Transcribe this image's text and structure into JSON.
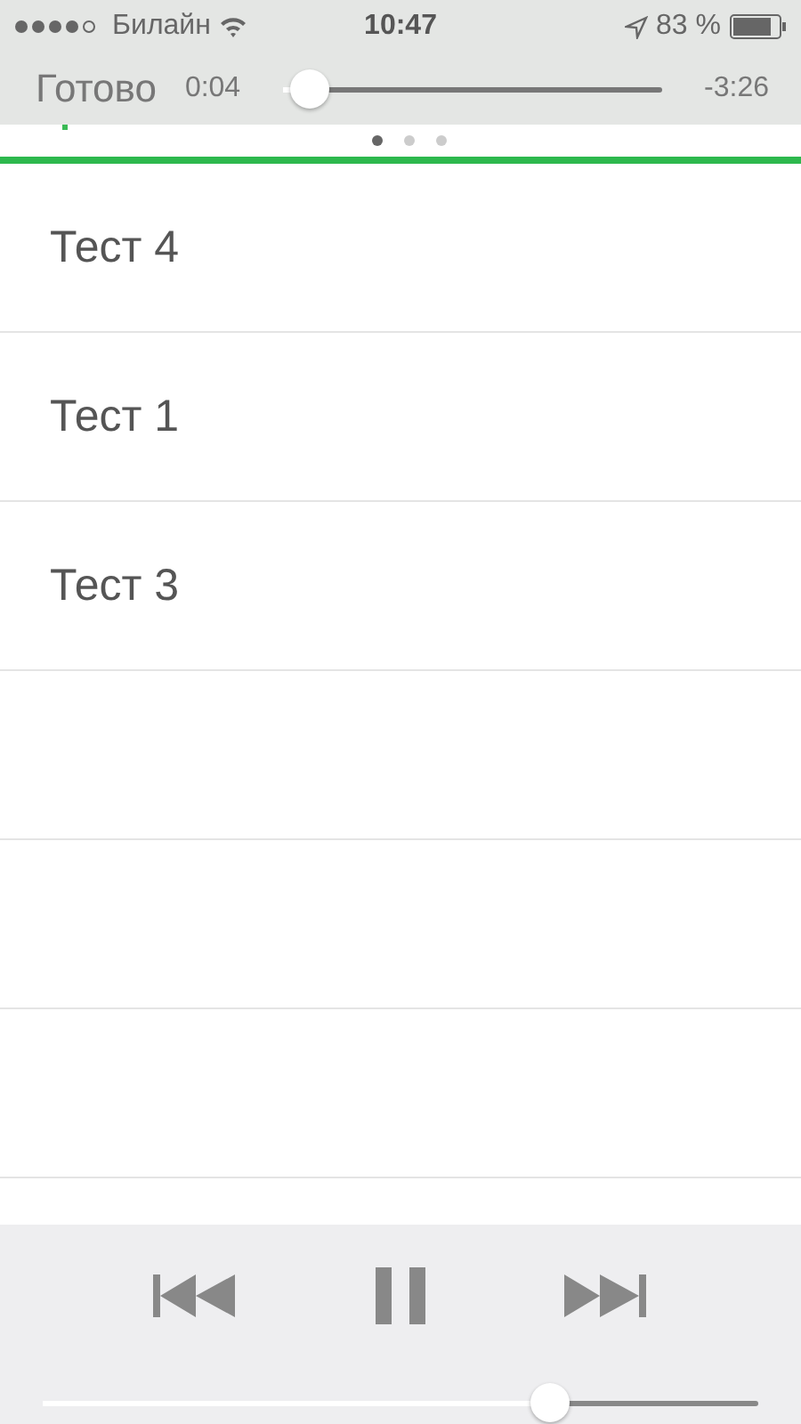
{
  "status_bar": {
    "carrier": "Билайн",
    "time": "10:47",
    "battery": "83 %"
  },
  "player": {
    "done": "Готово",
    "elapsed": "0:04",
    "remaining": "-3:26",
    "level": 0.07
  },
  "pages": [
    {
      "selected": true
    },
    {
      "selected": false
    },
    {
      "selected": false
    }
  ],
  "tracks": [
    {
      "title": "Тест 4"
    },
    {
      "title": "Тест 1"
    },
    {
      "title": "Тест 3"
    }
  ],
  "volume": {
    "level": 0.71
  }
}
